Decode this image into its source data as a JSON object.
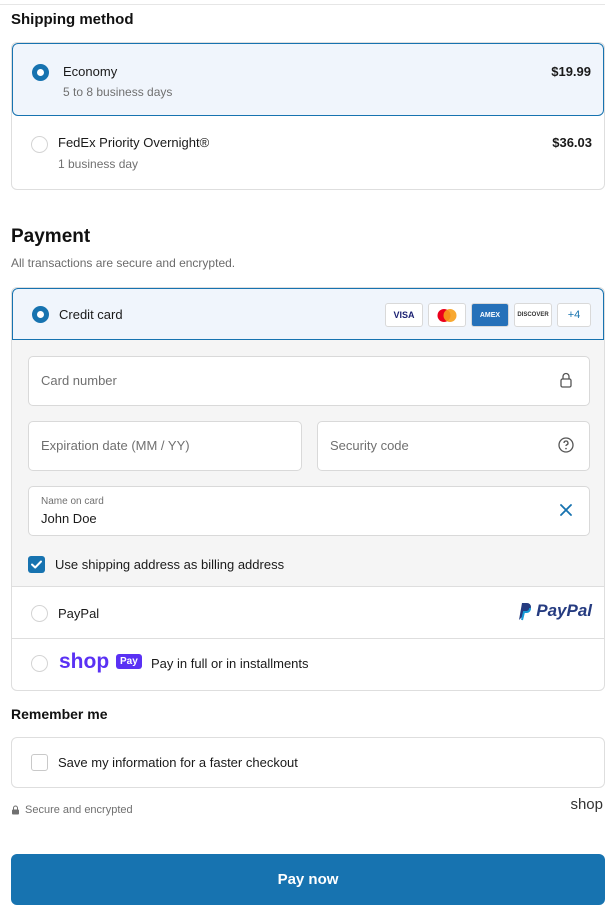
{
  "shipping": {
    "title": "Shipping method",
    "options": [
      {
        "name": "Economy",
        "sub": "5 to 8 business days",
        "price": "$19.99",
        "selected": true
      },
      {
        "name": "FedEx Priority Overnight®",
        "sub": "1 business day",
        "price": "$36.03",
        "selected": false
      }
    ]
  },
  "payment": {
    "title": "Payment",
    "subtitle": "All transactions are secure and encrypted.",
    "credit_card": {
      "label": "Credit card",
      "badges": [
        "VISA",
        "mastercard-icon",
        "AMEX",
        "DISCOVER"
      ],
      "more_badge": "+4",
      "card_number_placeholder": "Card number",
      "expiration_placeholder": "Expiration date (MM / YY)",
      "security_placeholder": "Security code",
      "name_label": "Name on card",
      "name_value": "John Doe",
      "billing_checkbox_label": "Use shipping address as billing address",
      "billing_checked": true
    },
    "paypal": {
      "label": "PayPal",
      "logo_text": "PayPal"
    },
    "shop_pay": {
      "logo_text": "shop",
      "badge_text": "Pay",
      "label": "Pay in full or in installments"
    }
  },
  "remember": {
    "title": "Remember me",
    "checkbox_label": "Save my information for a faster checkout",
    "checked": false
  },
  "footer": {
    "secure_label": "Secure and encrypted",
    "shop_text": "shop"
  },
  "pay_button": "Pay now",
  "colors": {
    "accent": "#1773b0",
    "shop_purple": "#5a31f4",
    "paypal_dark": "#253b80",
    "paypal_light": "#179bd7"
  }
}
